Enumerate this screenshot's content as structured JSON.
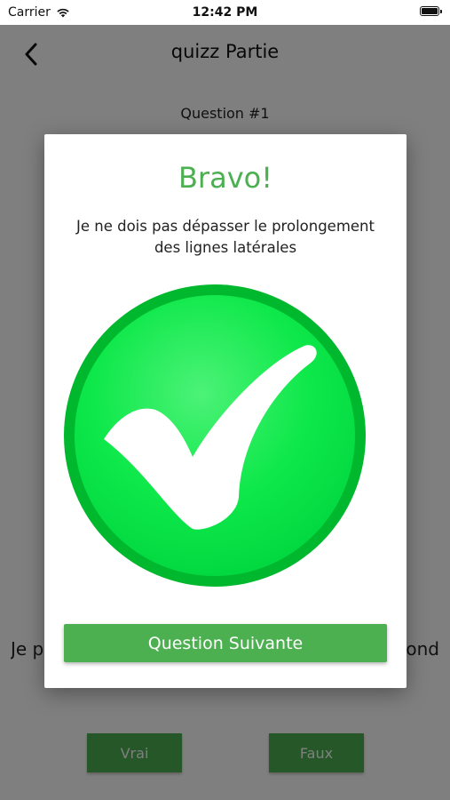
{
  "status_bar": {
    "carrier": "Carrier",
    "time": "12:42 PM",
    "icons": [
      "wifi-icon",
      "battery-icon"
    ]
  },
  "nav": {
    "title": "quizz Partie",
    "back_icon": "chevron-left-icon"
  },
  "quiz": {
    "question_number": "Question #1",
    "question_text_left": "Je p",
    "question_text_right": "ond",
    "answers": {
      "vrai": "Vrai",
      "faux": "Faux"
    }
  },
  "modal": {
    "title": "Bravo!",
    "message": "Je ne dois pas dépasser le prolongement des lignes latérales",
    "icon": "checkmark-circle-icon",
    "next_button": "Question Suivante"
  },
  "colors": {
    "accent_green": "#4caf50",
    "check_circle_green": "#00e040",
    "check_circle_ring": "#00b82e",
    "overlay": "rgba(0,0,0,0.5)"
  }
}
